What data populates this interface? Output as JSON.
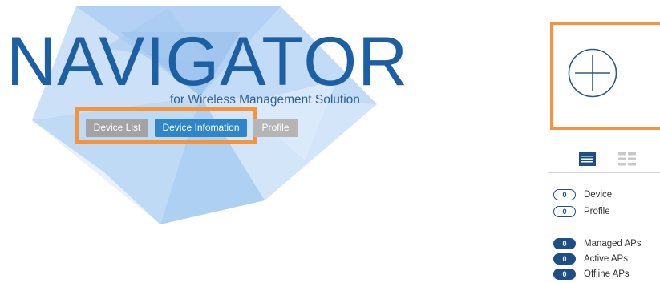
{
  "logo": {
    "title": "NAVIGATOR",
    "subtitle": "for Wireless Management Solution"
  },
  "tabs": {
    "device_list": "Device List",
    "device_information": "Device Infomation",
    "profile": "Profile"
  },
  "add_panel": {
    "icon": "plus-circle-icon"
  },
  "view_toggle": {
    "list_icon": "list-view-icon",
    "grid_icon": "grid-view-icon"
  },
  "counts": {
    "device": {
      "value": "0",
      "label": "Device"
    },
    "profile": {
      "value": "0",
      "label": "Profile"
    },
    "managed_aps": {
      "value": "0",
      "label": "Managed APs"
    },
    "active_aps": {
      "value": "0",
      "label": "Active APs"
    },
    "offline_aps": {
      "value": "0",
      "label": "Offline APs"
    }
  },
  "colors": {
    "brand_blue": "#1d5fa3",
    "accent_blue": "#2e86c9",
    "highlight_orange": "#f5943b",
    "dark_navy": "#1d4f86"
  }
}
